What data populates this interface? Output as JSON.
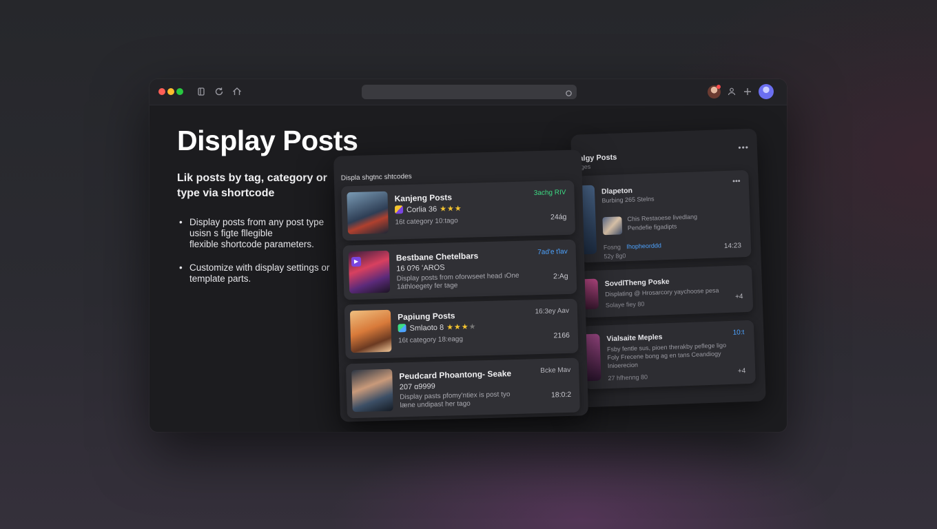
{
  "window": {
    "url": "",
    "traffic_lights": {
      "close": "#ff5f57",
      "minimize": "#febc2e",
      "maximize": "#28c840"
    }
  },
  "hero": {
    "title": "Display Posts",
    "subtitle_line1": "Lik posts by tag, category or",
    "subtitle_line2": "type via shortcode",
    "bullets": [
      {
        "lines": [
          "Display posts from any post type",
          "usisn s figte fllegible",
          "flexible shortcode parameters."
        ]
      },
      {
        "lines": [
          "Customize with display settings or",
          "template parts."
        ]
      }
    ]
  },
  "front_panel": {
    "header": "Displa shgtnc shtcodes",
    "cards": [
      {
        "title": "Kanjeng Posts",
        "sub": "Corlia 36",
        "stars": 3,
        "star_total": 3,
        "meta": "16t category 10:tago",
        "tag": "3achg RIV",
        "tag_color": "#3ddc84",
        "value": "24ág"
      },
      {
        "title": "Bestbane Chetelbars",
        "sub": "16 0?6 ʻAROS",
        "desc1": "Display posts from oforwseet head ıOne",
        "desc2": "1áthloegety fer tage",
        "tag": "7ad'e ťlav",
        "tag_color": "#4da3ff",
        "value": "2:Ag"
      },
      {
        "title": "Papiung Posts",
        "sub": "Smlaoto 8",
        "stars": 3,
        "star_total": 4,
        "meta": "16t category 18:eagg",
        "tag": "16:3ey Aav",
        "tag_color": "#b9b9c0",
        "value": "2166"
      },
      {
        "title": "Peudcard Phoantong- Seake",
        "sub": "207 ɑ9999",
        "desc1": "Display pasts pfomy'ntiex is post tyo",
        "desc2": "læne undipast her tago",
        "tag": "Bcke Mav",
        "tag_color": "#b9b9c0",
        "value": "18:0:2"
      }
    ]
  },
  "back_panel": {
    "title": "lalgy Posts",
    "subtitle": "ages",
    "cards": [
      {
        "title": "Dlapeton",
        "sub": "Burbing 265 Stelns",
        "line2": "Chis Restaoese livedlang",
        "line3": "Pendefie figadipts",
        "meta_left": "Fosng",
        "meta_link": "Ihopheorddd",
        "meta2": "52y 8g0",
        "value": "14:23"
      },
      {
        "title": "SovdlTheng Poske",
        "sub": "Displating @ Hrosarcory yaychoose pesa",
        "meta": "Solaye fiey 80",
        "value": "+4"
      },
      {
        "title": "Vialsaite Meples",
        "sub": "Fsby fentle sus, pioen therakby peflege ligo",
        "line2": "Foly Frecene bong ag en tans Ceandiogy",
        "line3": "Inioerecion",
        "meta": "27 hfhenng 80",
        "tag": "10:t",
        "value": "+4"
      }
    ]
  }
}
